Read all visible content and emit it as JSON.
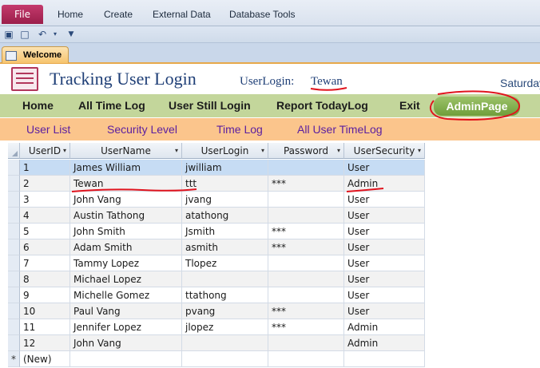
{
  "ribbon": {
    "file": "File",
    "tabs": [
      "Home",
      "Create",
      "External Data",
      "Database Tools"
    ]
  },
  "doc_tab": {
    "label": "Welcome"
  },
  "header": {
    "title": "Tracking User Login",
    "userlogin_label": "UserLogin:",
    "userlogin_value": "Tewan",
    "date_text": "Saturday"
  },
  "nav_primary": [
    "Home",
    "All Time Log",
    "User Still Login",
    "Report TodayLog",
    "Exit",
    "AdminPage"
  ],
  "nav_secondary": [
    "User List",
    "Security Level",
    "Time Log",
    "All User TimeLog"
  ],
  "grid": {
    "columns": [
      "UserID",
      "UserName",
      "UserLogin",
      "Password",
      "UserSecurity"
    ],
    "rows": [
      [
        "1",
        "James William",
        "jwilliam",
        "",
        "User"
      ],
      [
        "2",
        "Tewan",
        "ttt",
        "***",
        "Admin"
      ],
      [
        "3",
        "John Vang",
        "jvang",
        "",
        "User"
      ],
      [
        "4",
        "Austin Tathong",
        "atathong",
        "",
        "User"
      ],
      [
        "5",
        "John Smith",
        "Jsmith",
        "***",
        "User"
      ],
      [
        "6",
        "Adam Smith",
        "asmith",
        "***",
        "User"
      ],
      [
        "7",
        "Tammy Lopez",
        "Tlopez",
        "",
        "User"
      ],
      [
        "8",
        "Michael Lopez",
        "",
        "",
        "User"
      ],
      [
        "9",
        "Michelle Gomez",
        "ttathong",
        "",
        "User"
      ],
      [
        "10",
        "Paul Vang",
        "pvang",
        "***",
        "User"
      ],
      [
        "11",
        "Jennifer Lopez",
        "jlopez",
        "***",
        "Admin"
      ],
      [
        "12",
        "John Vang",
        "",
        "",
        "Admin"
      ]
    ],
    "new_row_label": "(New)",
    "new_row_marker": "*"
  },
  "colors": {
    "nav_primary_bg": "#c3d69b",
    "nav_secondary_bg": "#fbc58c",
    "title": "#1f3f77",
    "annotation": "#e0141e"
  }
}
